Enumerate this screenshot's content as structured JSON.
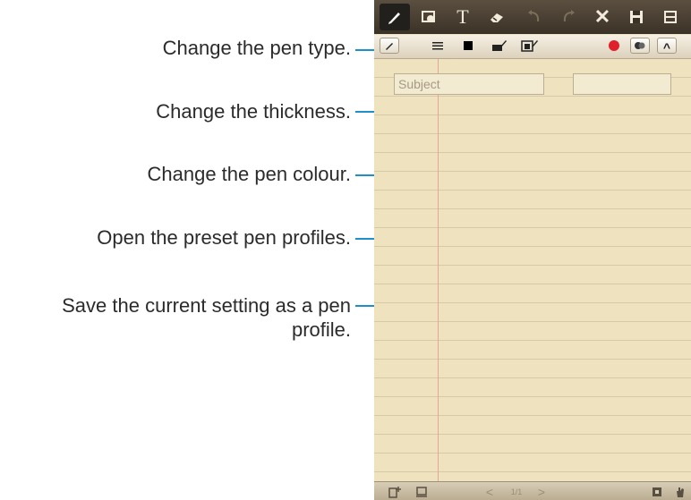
{
  "callouts": [
    "Change the pen type.",
    "Change the thickness.",
    "Change the pen colour.",
    "Open the preset pen profiles.",
    "Save the current setting as a pen profile."
  ],
  "toolbar": {
    "icons": [
      "pen-icon",
      "image-icon",
      "text-icon",
      "eraser-icon",
      "undo-icon",
      "redo-icon",
      "delete-icon",
      "save-icon",
      "more-icon"
    ],
    "text_glyph": "T",
    "delete_glyph": "✕"
  },
  "pen_settings": {
    "icons": [
      "pen-type-icon",
      "thickness-icon",
      "pen-colour-icon",
      "preset-profiles-icon",
      "save-profile-icon",
      "record-icon",
      "palette-icon",
      "collapse-icon"
    ],
    "collapse_glyph": "^"
  },
  "note": {
    "subject_placeholder": "Subject"
  },
  "bottom_bar": {
    "page_indicator": "1/1",
    "prev_glyph": "<",
    "next_glyph": ">"
  },
  "colors": {
    "accent": "#1f8fc9",
    "paper": "#efe2bf",
    "record": "#e0202b"
  }
}
